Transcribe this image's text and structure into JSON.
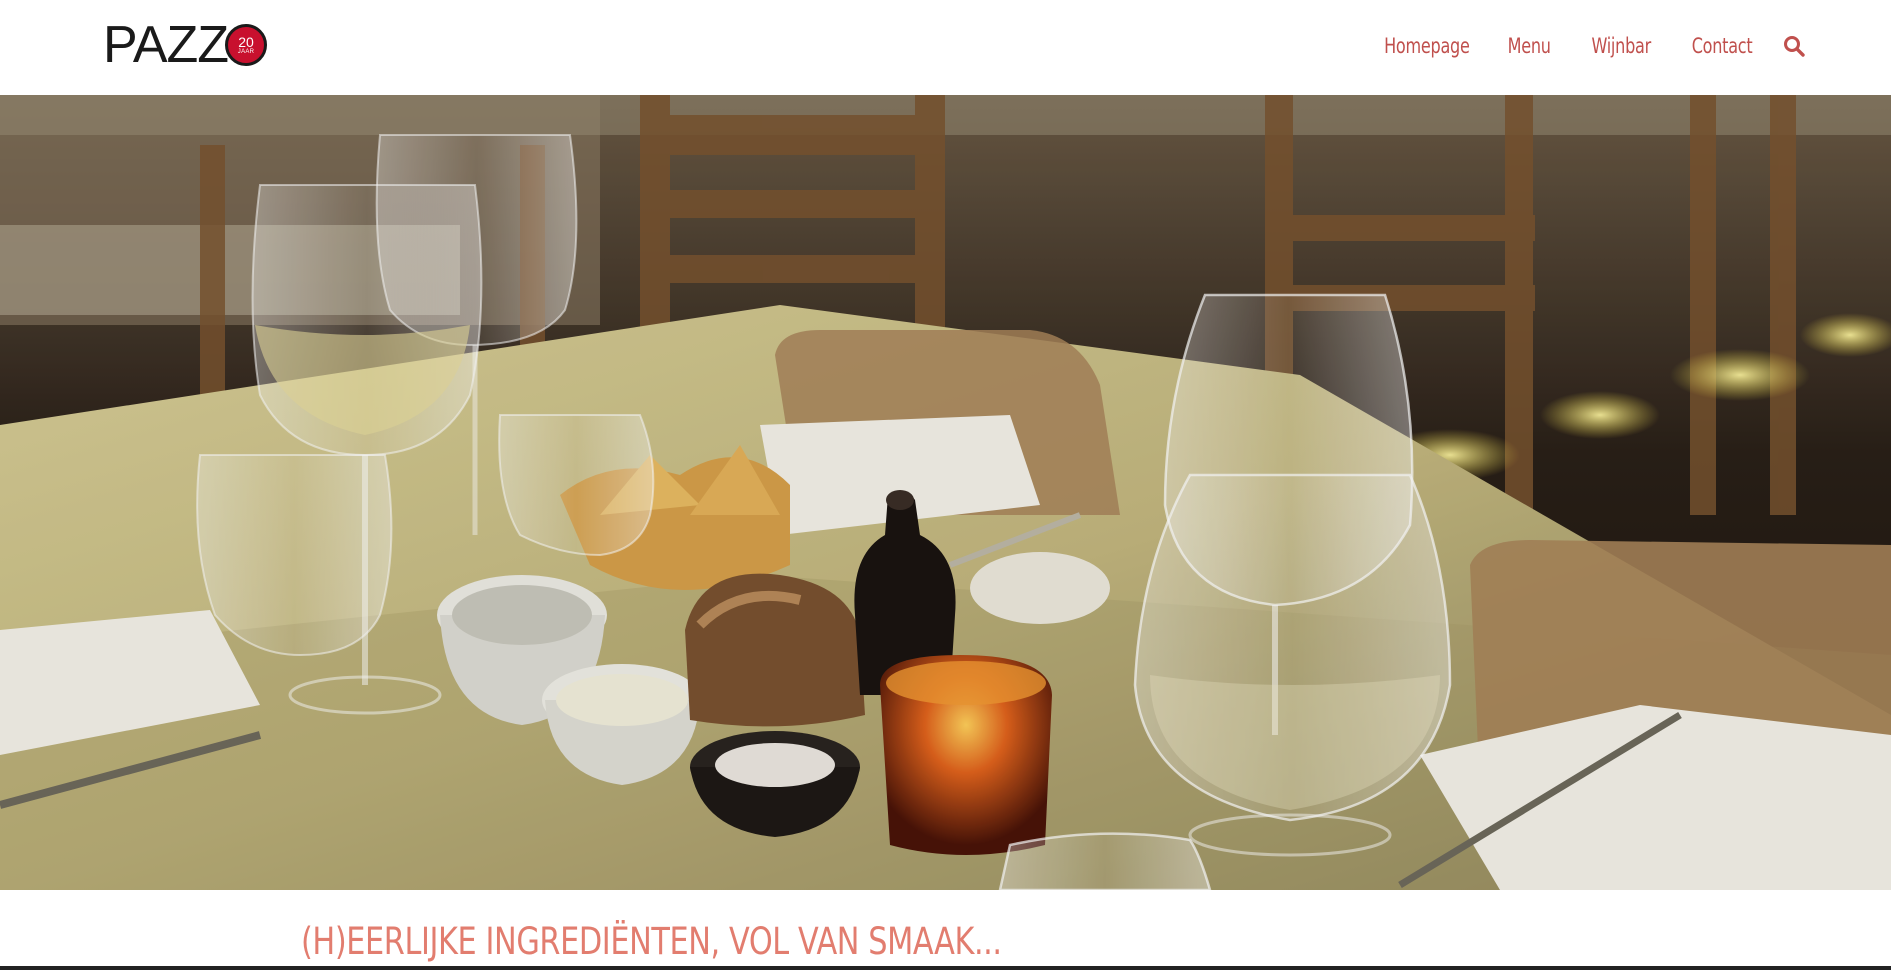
{
  "header": {
    "logo": {
      "text": "PAZZ",
      "badge_number": "20",
      "badge_unit": "JAAR"
    },
    "nav": [
      {
        "label": "Homepage"
      },
      {
        "label": "Menu"
      },
      {
        "label": "Wijnbar"
      },
      {
        "label": "Contact"
      }
    ],
    "search_icon": "search-icon"
  },
  "main": {
    "tagline": "(H)EERLIJKE INGREDIËNTEN, VOL VAN SMAAK..."
  },
  "colors": {
    "accent": "#c0504d",
    "tagline": "#e27d6f",
    "logo_badge": "#c8102e"
  }
}
